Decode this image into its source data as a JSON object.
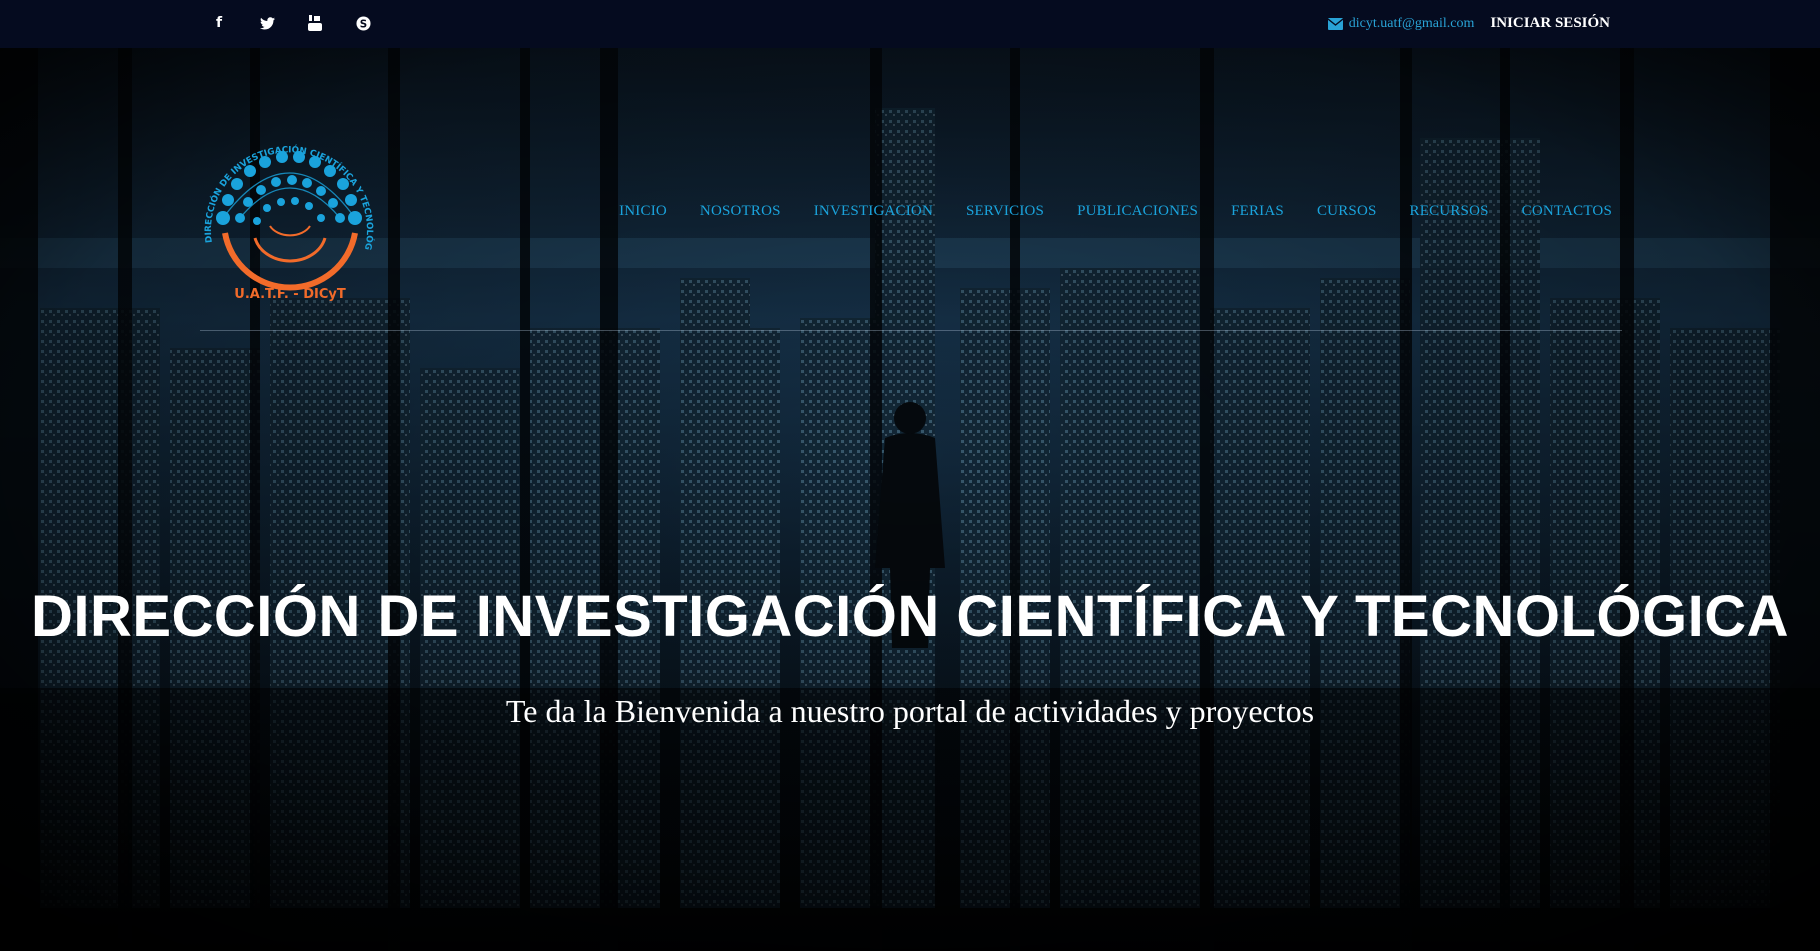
{
  "topbar": {
    "social": [
      {
        "icon": "facebook-icon",
        "glyph": "f"
      },
      {
        "icon": "twitter-icon",
        "glyph": "🐦"
      },
      {
        "icon": "youtube-icon",
        "glyph": "▶"
      },
      {
        "icon": "skype-icon",
        "glyph": "S"
      }
    ],
    "email": "dicyt.uatf@gmail.com",
    "login": "INICIAR SESIÓN"
  },
  "logo": {
    "arc_text": "DIRECCIÓN DE INVESTIGACIÓN CIENTÍFICA Y TECNOLÓGICA",
    "bottom_text": "U.A.T.F. - DICyT"
  },
  "nav": {
    "items": [
      {
        "label": "INICIO"
      },
      {
        "label": "NOSOTROS"
      },
      {
        "label": "INVESTIGACION"
      },
      {
        "label": "SERVICIOS"
      },
      {
        "label": "PUBLICACIONES"
      },
      {
        "label": "FERIAS"
      },
      {
        "label": "CURSOS"
      },
      {
        "label": "RECURSOS"
      },
      {
        "label": "CONTACTOS"
      }
    ]
  },
  "hero": {
    "title": "DIRECCIÓN DE INVESTIGACIÓN CIENTÍFICA Y TECNOLÓGICA",
    "subtitle": "Te da la Bienvenida a nuestro portal de actividades y proyectos",
    "slide_count": 6
  },
  "colors": {
    "accent": "#1aa3dc",
    "topbar_bg": "#050b1f",
    "logo_orange": "#f26b2a"
  }
}
